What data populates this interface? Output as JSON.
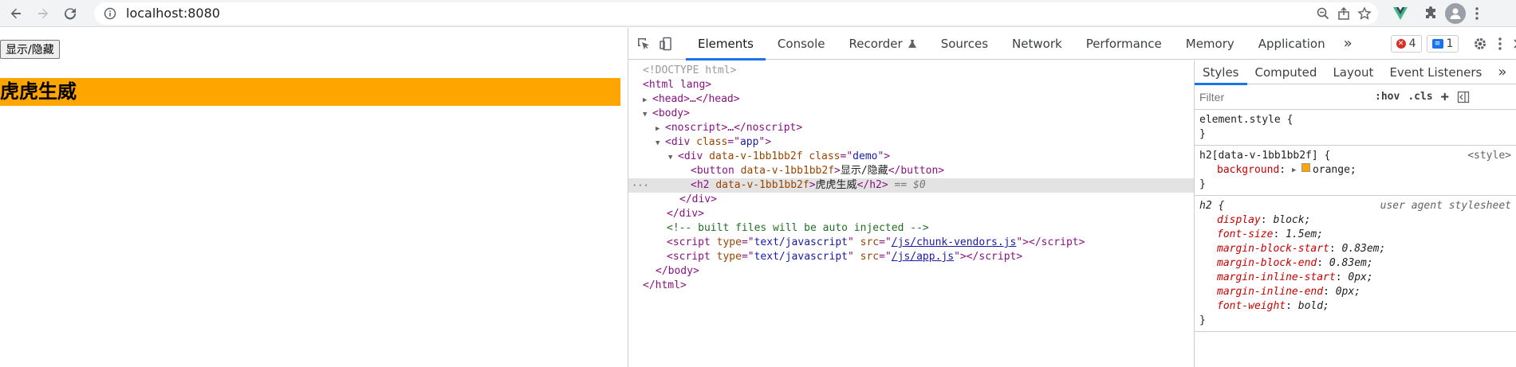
{
  "browser": {
    "url": "localhost:8080",
    "accent": "#1a73e8"
  },
  "page": {
    "button_label": "显示/隐藏",
    "h2_text": "虎虎生威",
    "h2_background": "#ffa500"
  },
  "devtools": {
    "tabs": [
      "Elements",
      "Console",
      "Recorder",
      "Sources",
      "Network",
      "Performance",
      "Memory",
      "Application"
    ],
    "active_tab": "Elements",
    "more_tabs": "»",
    "error_count": "4",
    "message_count": "1",
    "dom": {
      "doctype": "<!DOCTYPE html>",
      "html_open": "<html lang>",
      "head_collapsed": "<head>…</head>",
      "body_open": "<body>",
      "noscript_collapsed": "<noscript>…</noscript>",
      "div_app_class": "app",
      "div_demo_attr": "data-v-1bb1bb2f",
      "div_demo_class": "demo",
      "button_attr": "data-v-1bb1bb2f",
      "button_text": "显示/隐藏",
      "h2_attr": "data-v-1bb1bb2f",
      "h2_text": "虎虎生威",
      "selected_marker": "== $0",
      "div_close": "</div>",
      "comment": "<!-- built files will be auto injected -->",
      "script1_type": "text/javascript",
      "script1_src": "/js/chunk-vendors.js",
      "script2_type": "text/javascript",
      "script2_src": "/js/app.js",
      "body_close": "</body>",
      "html_close": "</html>"
    },
    "styles": {
      "tabs": [
        "Styles",
        "Computed",
        "Layout",
        "Event Listeners"
      ],
      "active_tab": "Styles",
      "more_tabs": "»",
      "filter_placeholder": "Filter",
      "hov": ":hov",
      "cls": ".cls",
      "element_style": "element.style {",
      "rule1_selector": "h2[data-v-1bb1bb2f] {",
      "rule1_source": "<style>",
      "rule1_prop": "background",
      "rule1_value": "orange;",
      "rule2_selector": "h2 {",
      "rule2_source": "user agent stylesheet",
      "rule2_props": [
        {
          "name": "display",
          "value": "block;"
        },
        {
          "name": "font-size",
          "value": "1.5em;"
        },
        {
          "name": "margin-block-start",
          "value": "0.83em;"
        },
        {
          "name": "margin-block-end",
          "value": "0.83em;"
        },
        {
          "name": "margin-inline-start",
          "value": "0px;"
        },
        {
          "name": "margin-inline-end",
          "value": "0px;"
        },
        {
          "name": "font-weight",
          "value": "bold;"
        }
      ],
      "close_brace": "}"
    }
  }
}
